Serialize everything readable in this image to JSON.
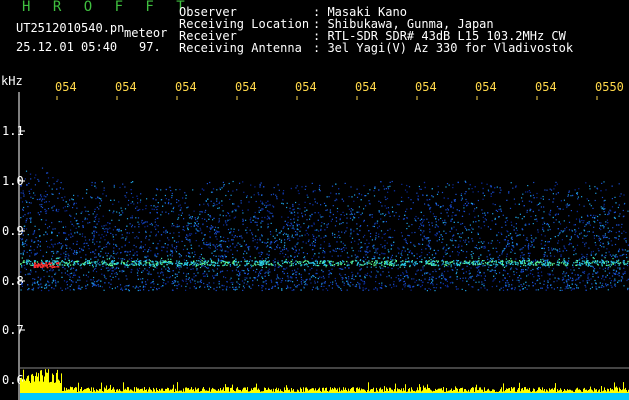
{
  "header": {
    "app_title": "H R O F F T",
    "filename": "UT2512010540.pn",
    "filename_suffix": "meteor",
    "datetime": "25.12.01 05:40",
    "value": "97.",
    "info": [
      {
        "label": "Observer",
        "value": ": Masaki Kano"
      },
      {
        "label": "Receiving Location",
        "value": ": Shibukawa, Gunma, Japan"
      },
      {
        "label": "Receiver",
        "value": ": RTL-SDR SDR# 43dB L15 103.2MHz CW"
      },
      {
        "label": "Receiving Antenna",
        "value": ": 3el Yagi(V) Az 330 for Vladivostok"
      }
    ]
  },
  "axis": {
    "unit": "kHz",
    "y_ticks": [
      "1.1",
      "1.0",
      "0.9",
      "0.8",
      "0.7",
      "0.6"
    ],
    "x_ticks": [
      "054",
      "054",
      "054",
      "054",
      "054",
      "054",
      "054",
      "054",
      "054",
      "0550"
    ]
  },
  "colors": {
    "background": "#000000",
    "title": "#3fbf3f",
    "text": "#ffffff",
    "time_labels": "#ffd84a",
    "signal_low": "#0a2a9a",
    "signal_mid": "#1fa0e0",
    "signal_high": "#ff3030",
    "meter_bar": "#ffff00",
    "meter_base": "#00c8ff"
  }
}
